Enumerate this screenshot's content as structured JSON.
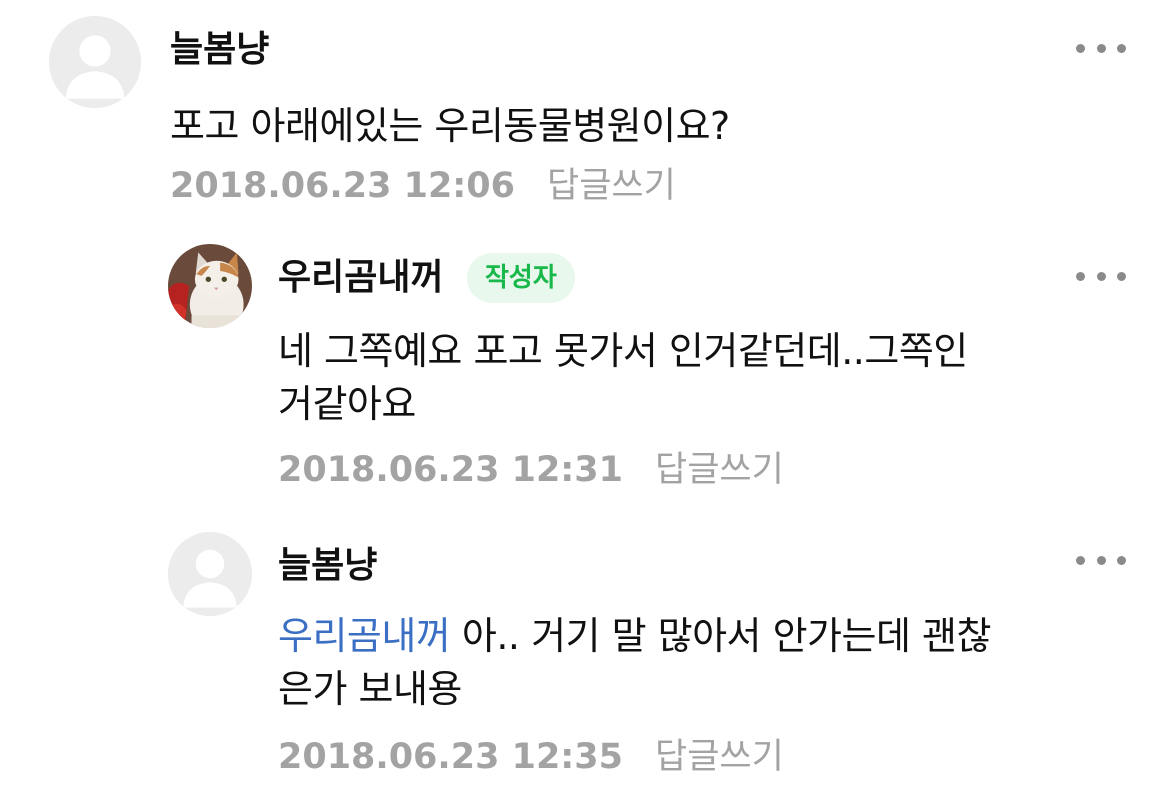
{
  "comments": [
    {
      "author": "늘봄냥",
      "text": "포고 아래에있는 우리동물병원이요?",
      "date": "2018.06.23 12:06",
      "reply_label": "답글쓰기"
    },
    {
      "author": "우리곰내꺼",
      "badge": "작성자",
      "text_line1": "네 그쪽예요 포고 못가서 인거같던데..그쪽인",
      "text_line2": "거같아요",
      "date": "2018.06.23 12:31",
      "reply_label": "답글쓰기"
    },
    {
      "author": "늘봄냥",
      "mention": "우리곰내꺼",
      "text_line1": " 아.. 거기 말 많아서 안가는데 괜찮",
      "text_line2": "은가 보내용",
      "date": "2018.06.23 12:35",
      "reply_label": "답글쓰기"
    }
  ],
  "icons": {
    "default_avatar": "person-silhouette-icon",
    "cat_avatar": "cat-photo-avatar",
    "more": "more-dots-icon"
  },
  "colors": {
    "badge_text": "#19b84a",
    "badge_bg": "#e8f8ec",
    "mention": "#3b6fc4",
    "meta": "#a3a3a3"
  }
}
